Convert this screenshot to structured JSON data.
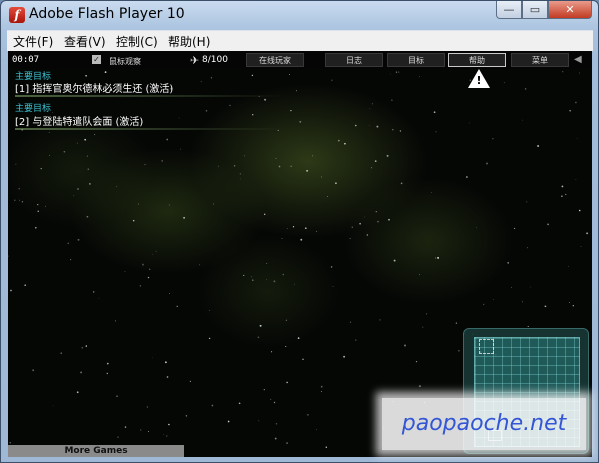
{
  "window": {
    "title": "Adobe Flash Player 10",
    "app_icon_glyph": "f",
    "buttons": {
      "minimize": "—",
      "maximize": "▭",
      "close": "✕"
    }
  },
  "menubar": {
    "items": [
      {
        "label": "文件(F)"
      },
      {
        "label": "查看(V)"
      },
      {
        "label": "控制(C)"
      },
      {
        "label": "帮助(H)"
      }
    ]
  },
  "hud": {
    "timer": "00:07",
    "mouse_observe_label": "鼠标观察",
    "mouse_observe_checked": true,
    "ship_count": "8/100",
    "nav": [
      {
        "label": "在线玩家"
      },
      {
        "label": "日志"
      },
      {
        "label": "目标"
      },
      {
        "label": "帮助",
        "active": true
      },
      {
        "label": "菜单"
      }
    ]
  },
  "objectives": [
    {
      "heading": "主要目标",
      "text": "[1] 指挥官奥尔德林必须生还 (激活)"
    },
    {
      "heading": "主要目标",
      "text": "[2] 与登陆特遣队会面 (激活)"
    }
  ],
  "more_games_label": "More Games",
  "watermark_text": "paopaoche.net",
  "colors": {
    "objective_heading": "#38c4d4",
    "watermark": "#3355d6",
    "game_bg": "#050705"
  }
}
